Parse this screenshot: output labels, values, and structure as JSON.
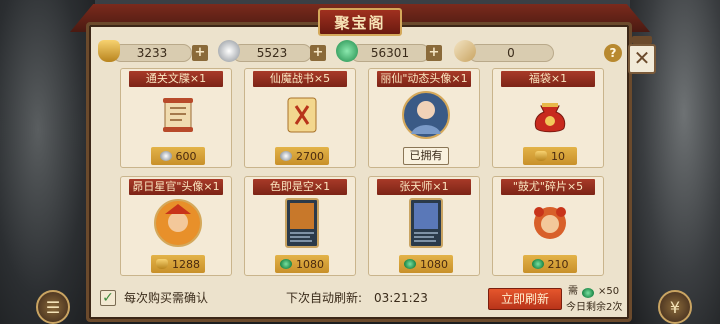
{
  "title": "聚宝阁",
  "resources": [
    {
      "icon": "gold-ingot-icon",
      "value": "3233"
    },
    {
      "icon": "silver-coin-icon",
      "value": "5523"
    },
    {
      "icon": "jade-icon",
      "value": "56301"
    },
    {
      "icon": "scroll-token-icon",
      "value": "0"
    }
  ],
  "help_label": "?",
  "cards": [
    {
      "title": "通关文牒×1",
      "icon": "scroll-icon",
      "price_icon": "silver-coin-icon",
      "price": "600"
    },
    {
      "title": "仙魔战书×5",
      "icon": "war-letter-icon",
      "price_icon": "silver-coin-icon",
      "price": "2700"
    },
    {
      "title": "丽仙\"动态头像×1",
      "icon": "portrait-icon",
      "owned_label": "已拥有"
    },
    {
      "title": "福袋×1",
      "icon": "lucky-bag-icon",
      "price_icon": "gold-ingot-icon",
      "price": "10"
    },
    {
      "title": "昴日星官\"头像×1",
      "icon": "avatar-icon",
      "price_icon": "gold-ingot-icon",
      "price": "1288"
    },
    {
      "title": "色即是空×1",
      "icon": "card-icon",
      "price_icon": "jade-icon",
      "price": "1080"
    },
    {
      "title": "张天师×1",
      "icon": "card-icon",
      "price_icon": "jade-icon",
      "price": "1080"
    },
    {
      "title": "\"鼓尤\"碎片×5",
      "icon": "fragment-icon",
      "price_icon": "jade-icon",
      "price": "210"
    }
  ],
  "footer": {
    "confirm_label": "每次购买需确认",
    "auto_refresh_label": "下次自动刷新:",
    "timer": "03:21:23",
    "refresh_button": "立即刷新",
    "cost_prefix": "需",
    "cost_value": "×50",
    "remaining_label": "今日剩余2次"
  },
  "colors": {
    "title_red": "#7c2416",
    "price_gold": "#c8902a",
    "parchment": "#ece2cc",
    "refresh_orange": "#e5562c"
  }
}
